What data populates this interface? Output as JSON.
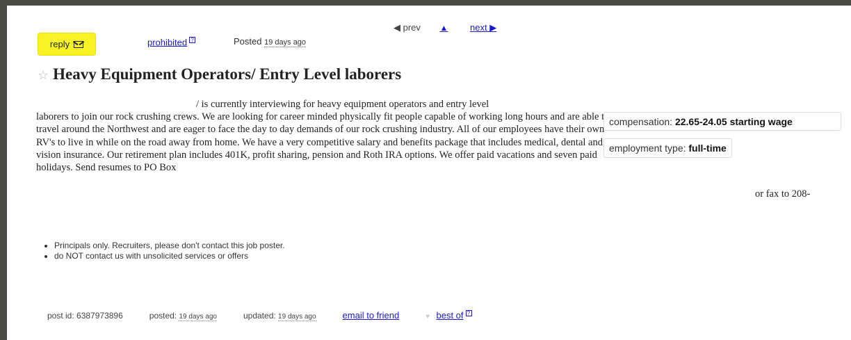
{
  "nav": {
    "prev": "◀ prev",
    "up": "▲",
    "next": "next ▶"
  },
  "header": {
    "reply_label": "reply",
    "prohibited_label": "prohibited",
    "posted_label": "Posted",
    "posted_time": "19 days ago"
  },
  "title": "Heavy Equipment Operators/ Entry Level laborers",
  "body": {
    "first_line": "/ is currently interviewing for heavy equipment operators and entry level",
    "rest": "laborers to join our rock crushing crews. We are looking for career minded physically fit people capable of working long hours and are able to travel around the Northwest and are eager to face the day to day demands of our rock crushing industry. All of our employees have their own RV's to live in while on the road away from home. We have a very competitive salary and benefits package that includes medical, dental and vision insurance. Our retirement plan includes 401K, profit sharing, pension and Roth IRA options. We offer paid vacations and seven paid holidays. Send resumes to PO Box",
    "fax_tail": "or fax to 208-"
  },
  "attributes": {
    "compensation_label": "compensation:",
    "compensation_value": "22.65-24.05 starting wage",
    "employment_label": "employment type:",
    "employment_value": "full-time"
  },
  "notices": [
    "Principals only. Recruiters, please don't contact this job poster.",
    "do NOT contact us with unsolicited services or offers"
  ],
  "footer": {
    "post_id": "post id: 6387973896",
    "posted_label": "posted:",
    "posted_time": "19 days ago",
    "updated_label": "updated:",
    "updated_time": "19 days ago",
    "email_label": "email to friend",
    "best_of_label": "best of"
  }
}
